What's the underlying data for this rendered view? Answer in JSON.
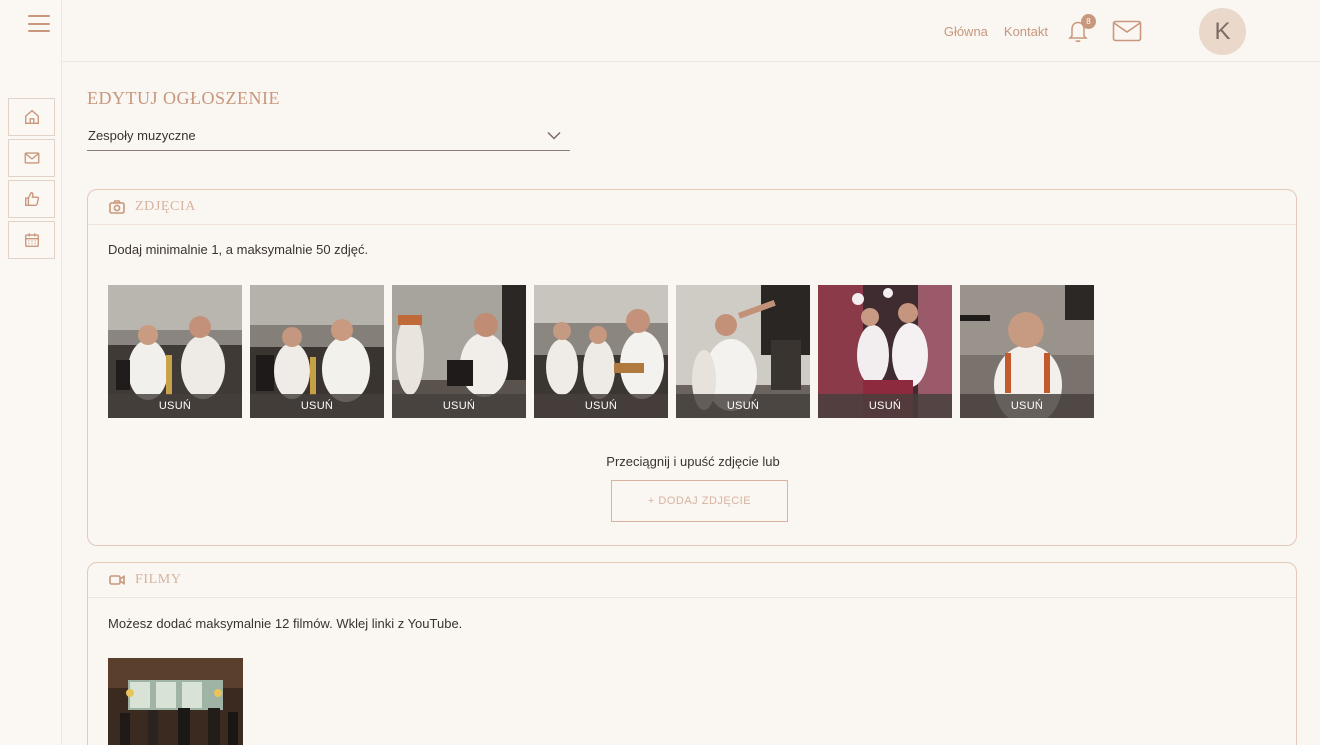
{
  "header": {
    "links": [
      "Główna",
      "Kontakt"
    ],
    "notification_count": "8",
    "avatar_initial": "K"
  },
  "rail": {
    "icons": [
      "home-icon",
      "mail-icon",
      "thumbs-up-icon",
      "calendar-icon"
    ]
  },
  "page": {
    "title": "EDYTUJ OGŁOSZENIE",
    "category_value": "Zespoły muzyczne"
  },
  "photos_section": {
    "title": "ZDJĘCIA",
    "hint": "Dodaj minimalnie 1, a maksymalnie 50 zdjęć.",
    "remove_label": "USUŃ",
    "drop_text": "Przeciągnij i upuść zdjęcie lub",
    "add_label": "+ DODAJ ZDJĘCIE",
    "photo_count": 7
  },
  "films_section": {
    "title": "FILMY",
    "hint": "Możesz dodać maksymalnie 12 filmów. Wklej linki z YouTube."
  },
  "colors": {
    "accent": "#c8977d",
    "background": "#faf6f1",
    "border": "#e3c9b9"
  }
}
